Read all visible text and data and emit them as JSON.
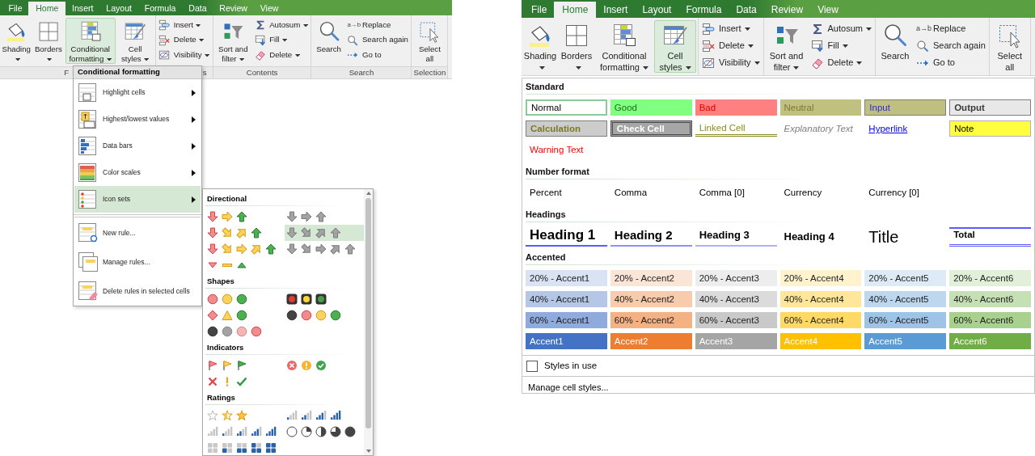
{
  "left_view": {
    "ribbon": {
      "tabs": [
        {
          "label": "File",
          "selected": false
        },
        {
          "label": "Home",
          "selected": true
        },
        {
          "label": "Insert",
          "selected": false
        },
        {
          "label": "Layout",
          "selected": false
        },
        {
          "label": "Formula",
          "selected": false
        },
        {
          "label": "Data",
          "selected": false
        },
        {
          "label": "Review",
          "selected": false
        },
        {
          "label": "View",
          "selected": false
        }
      ],
      "groups": [
        {
          "label": "F",
          "large": [
            {
              "kind": "shading",
              "label": "Shading",
              "dropdown": true,
              "selected": false
            },
            {
              "kind": "borders",
              "label": "Borders",
              "dropdown": true,
              "selected": false
            },
            {
              "kind": "conditional",
              "label": "Conditional formatting",
              "dropdown": true,
              "selected": true
            },
            {
              "kind": "cellstyles",
              "label": "Cell styles",
              "dropdown": true,
              "selected": false
            }
          ]
        },
        {
          "label": "s",
          "small": [
            {
              "kind": "insert",
              "label": "Insert",
              "dropdown": true
            },
            {
              "kind": "delete",
              "label": "Delete",
              "dropdown": true
            },
            {
              "kind": "visibility",
              "label": "Visibility",
              "dropdown": true
            }
          ]
        },
        {
          "label": "Contents",
          "large": [
            {
              "kind": "sort",
              "label": "Sort and filter",
              "dropdown": true,
              "selected": false
            }
          ],
          "small": [
            {
              "kind": "autosum",
              "label": "Autosum",
              "dropdown": true
            },
            {
              "kind": "fill",
              "label": "Fill",
              "dropdown": true
            },
            {
              "kind": "clear",
              "label": "Delete",
              "dropdown": true
            }
          ]
        },
        {
          "label": "Search",
          "large": [
            {
              "kind": "search",
              "label": "Search",
              "dropdown": false,
              "selected": false
            }
          ],
          "small": [
            {
              "kind": "replace",
              "label": "Replace",
              "icon_text": "a→b",
              "dropdown": false
            },
            {
              "kind": "searchagain",
              "label": "Search again",
              "dropdown": false
            },
            {
              "kind": "goto",
              "label": "Go to",
              "dropdown": false
            }
          ]
        },
        {
          "label": "Selection",
          "large": [
            {
              "kind": "selectall",
              "label": "Select all",
              "dropdown": false,
              "selected": false
            }
          ]
        }
      ]
    },
    "conditional_menu": {
      "title": "Conditional formatting",
      "items": [
        {
          "kind": "highlight",
          "label": "Highlight cells",
          "submenu": true,
          "selected": false,
          "separator_before": false
        },
        {
          "kind": "topbottom",
          "label": "Highest/lowest values",
          "submenu": true,
          "selected": false,
          "separator_before": false
        },
        {
          "kind": "databars",
          "label": "Data bars",
          "submenu": true,
          "selected": false,
          "separator_before": false
        },
        {
          "kind": "colorscales",
          "label": "Color scales",
          "submenu": true,
          "selected": false,
          "separator_before": false
        },
        {
          "kind": "iconsets",
          "label": "Icon sets",
          "submenu": true,
          "selected": true,
          "separator_before": false
        },
        {
          "kind": "newrule",
          "label": "New rule...",
          "submenu": false,
          "selected": false,
          "separator_before": true
        },
        {
          "kind": "managerules",
          "label": "Manage rules...",
          "submenu": false,
          "selected": false,
          "separator_before": false
        },
        {
          "kind": "deleterules",
          "label": "Delete rules in selected cells",
          "submenu": false,
          "selected": false,
          "separator_before": false
        }
      ]
    },
    "icon_sets": {
      "sections": [
        {
          "title": "Directional",
          "sets": [
            {
              "kind": "arrows3",
              "selected": false
            },
            {
              "kind": "arrows3gray",
              "selected": false
            },
            {
              "kind": "arrows4",
              "selected": false
            },
            {
              "kind": "arrows4gray",
              "selected": true
            },
            {
              "kind": "arrows5",
              "selected": false
            },
            {
              "kind": "arrows5gray",
              "selected": false
            },
            {
              "kind": "triangles3",
              "selected": false
            }
          ]
        },
        {
          "title": "Shapes",
          "sets": [
            {
              "kind": "circles3",
              "selected": false
            },
            {
              "kind": "lights3",
              "selected": false
            },
            {
              "kind": "signs3",
              "selected": false
            },
            {
              "kind": "lights4",
              "selected": false
            },
            {
              "kind": "redblack4",
              "selected": false
            }
          ]
        },
        {
          "title": "Indicators",
          "sets": [
            {
              "kind": "flags3",
              "selected": false
            },
            {
              "kind": "symbolscircled3",
              "selected": false
            },
            {
              "kind": "symbols3",
              "selected": false
            }
          ]
        },
        {
          "title": "Ratings",
          "sets": [
            {
              "kind": "stars3",
              "selected": false
            },
            {
              "kind": "signal4",
              "selected": false
            },
            {
              "kind": "signal5",
              "selected": false
            },
            {
              "kind": "quarters5",
              "selected": false
            },
            {
              "kind": "boxes5",
              "selected": false
            }
          ]
        }
      ]
    }
  },
  "right_view": {
    "ribbon": {
      "tabs": [
        {
          "label": "File",
          "selected": false
        },
        {
          "label": "Home",
          "selected": true
        },
        {
          "label": "Insert",
          "selected": false
        },
        {
          "label": "Layout",
          "selected": false
        },
        {
          "label": "Formula",
          "selected": false
        },
        {
          "label": "Data",
          "selected": false
        },
        {
          "label": "Review",
          "selected": false
        },
        {
          "label": "View",
          "selected": false
        }
      ],
      "groups": [
        {
          "large": [
            {
              "kind": "shading",
              "label": "Shading",
              "dropdown": true,
              "selected": false
            },
            {
              "kind": "borders",
              "label": "Borders",
              "dropdown": true,
              "selected": false
            },
            {
              "kind": "conditional",
              "label": "Conditional formatting",
              "dropdown": true,
              "selected": false
            },
            {
              "kind": "cellstyles",
              "label": "Cell styles",
              "dropdown": true,
              "selected": true
            }
          ]
        },
        {
          "small": [
            {
              "kind": "insert",
              "label": "Insert",
              "dropdown": true
            },
            {
              "kind": "delete",
              "label": "Delete",
              "dropdown": true
            },
            {
              "kind": "visibility",
              "label": "Visibility",
              "dropdown": true
            }
          ]
        },
        {
          "large": [
            {
              "kind": "sort",
              "label": "Sort and filter",
              "dropdown": true,
              "selected": false
            }
          ],
          "small": [
            {
              "kind": "autosum",
              "label": "Autosum",
              "dropdown": true
            },
            {
              "kind": "fill",
              "label": "Fill",
              "dropdown": true
            },
            {
              "kind": "clear",
              "label": "Delete",
              "dropdown": true
            }
          ]
        },
        {
          "large": [
            {
              "kind": "search",
              "label": "Search",
              "dropdown": false,
              "selected": false
            }
          ],
          "small": [
            {
              "kind": "replace",
              "label": "Replace",
              "icon_text": "a→b",
              "dropdown": false
            },
            {
              "kind": "searchagain",
              "label": "Search again",
              "dropdown": false
            },
            {
              "kind": "goto",
              "label": "Go to",
              "dropdown": false
            }
          ]
        },
        {
          "large": [
            {
              "kind": "selectall",
              "label": "Select all",
              "dropdown": false,
              "selected": false
            }
          ]
        }
      ]
    },
    "cell_styles": {
      "sections": [
        {
          "title": "Standard",
          "styles": [
            {
              "kind": "normal",
              "label": "Normal"
            },
            {
              "kind": "good",
              "label": "Good"
            },
            {
              "kind": "bad",
              "label": "Bad"
            },
            {
              "kind": "neutral",
              "label": "Neutral"
            },
            {
              "kind": "input",
              "label": "Input"
            },
            {
              "kind": "output",
              "label": "Output"
            },
            {
              "kind": "calculation",
              "label": "Calculation"
            },
            {
              "kind": "check",
              "label": "Check Cell"
            },
            {
              "kind": "linked",
              "label": "Linked Cell"
            },
            {
              "kind": "explanatory",
              "label": "Explanatory Text"
            },
            {
              "kind": "hyperlink",
              "label": "Hyperlink"
            },
            {
              "kind": "note",
              "label": "Note"
            },
            {
              "kind": "warning",
              "label": "Warning Text"
            }
          ]
        },
        {
          "title": "Number format",
          "styles": [
            {
              "kind": "plain",
              "label": "Percent"
            },
            {
              "kind": "plain",
              "label": "Comma"
            },
            {
              "kind": "plain",
              "label": "Comma [0]"
            },
            {
              "kind": "plain",
              "label": "Currency"
            },
            {
              "kind": "plain",
              "label": "Currency [0]"
            }
          ]
        },
        {
          "title": "Headings",
          "styles": [
            {
              "kind": "heading1",
              "label": "Heading 1"
            },
            {
              "kind": "heading2",
              "label": "Heading 2"
            },
            {
              "kind": "heading3",
              "label": "Heading 3"
            },
            {
              "kind": "heading4",
              "label": "Heading 4"
            },
            {
              "kind": "title",
              "label": "Title"
            },
            {
              "kind": "total",
              "label": "Total"
            }
          ]
        },
        {
          "title": "Accented",
          "styles": [
            {
              "kind": "tint",
              "label": "20% - Accent1",
              "color": "#dae3f3"
            },
            {
              "kind": "tint",
              "label": "20% - Accent2",
              "color": "#fbe5d6"
            },
            {
              "kind": "tint",
              "label": "20% - Accent3",
              "color": "#ededed"
            },
            {
              "kind": "tint",
              "label": "20% - Accent4",
              "color": "#fff2cc"
            },
            {
              "kind": "tint",
              "label": "20% - Accent5",
              "color": "#deebf7"
            },
            {
              "kind": "tint",
              "label": "20% - Accent6",
              "color": "#e2f0d9"
            },
            {
              "kind": "tint",
              "label": "40% - Accent1",
              "color": "#b4c7e7"
            },
            {
              "kind": "tint",
              "label": "40% - Accent2",
              "color": "#f8cbad"
            },
            {
              "kind": "tint",
              "label": "40% - Accent3",
              "color": "#dbdbdb"
            },
            {
              "kind": "tint",
              "label": "40% - Accent4",
              "color": "#ffe699"
            },
            {
              "kind": "tint",
              "label": "40% - Accent5",
              "color": "#bdd7ee"
            },
            {
              "kind": "tint",
              "label": "40% - Accent6",
              "color": "#c5e0b4"
            },
            {
              "kind": "tint",
              "label": "60% - Accent1",
              "color": "#8faadc"
            },
            {
              "kind": "tint",
              "label": "60% - Accent2",
              "color": "#f4b183"
            },
            {
              "kind": "tint",
              "label": "60% - Accent3",
              "color": "#c9c9c9"
            },
            {
              "kind": "tint",
              "label": "60% - Accent4",
              "color": "#ffd966"
            },
            {
              "kind": "tint",
              "label": "60% - Accent5",
              "color": "#9dc3e6"
            },
            {
              "kind": "tint",
              "label": "60% - Accent6",
              "color": "#a9d18e"
            },
            {
              "kind": "solid",
              "label": "Accent1",
              "color": "#4472c4"
            },
            {
              "kind": "solid",
              "label": "Accent2",
              "color": "#ed7d31"
            },
            {
              "kind": "solid",
              "label": "Accent3",
              "color": "#a5a5a5"
            },
            {
              "kind": "solid",
              "label": "Accent4",
              "color": "#ffc000"
            },
            {
              "kind": "solid",
              "label": "Accent5",
              "color": "#5b9bd5"
            },
            {
              "kind": "solid",
              "label": "Accent6",
              "color": "#70ad47"
            }
          ]
        }
      ],
      "styles_in_use": {
        "label": "Styles in use",
        "checked": false
      },
      "manage": "Manage cell styles..."
    }
  }
}
